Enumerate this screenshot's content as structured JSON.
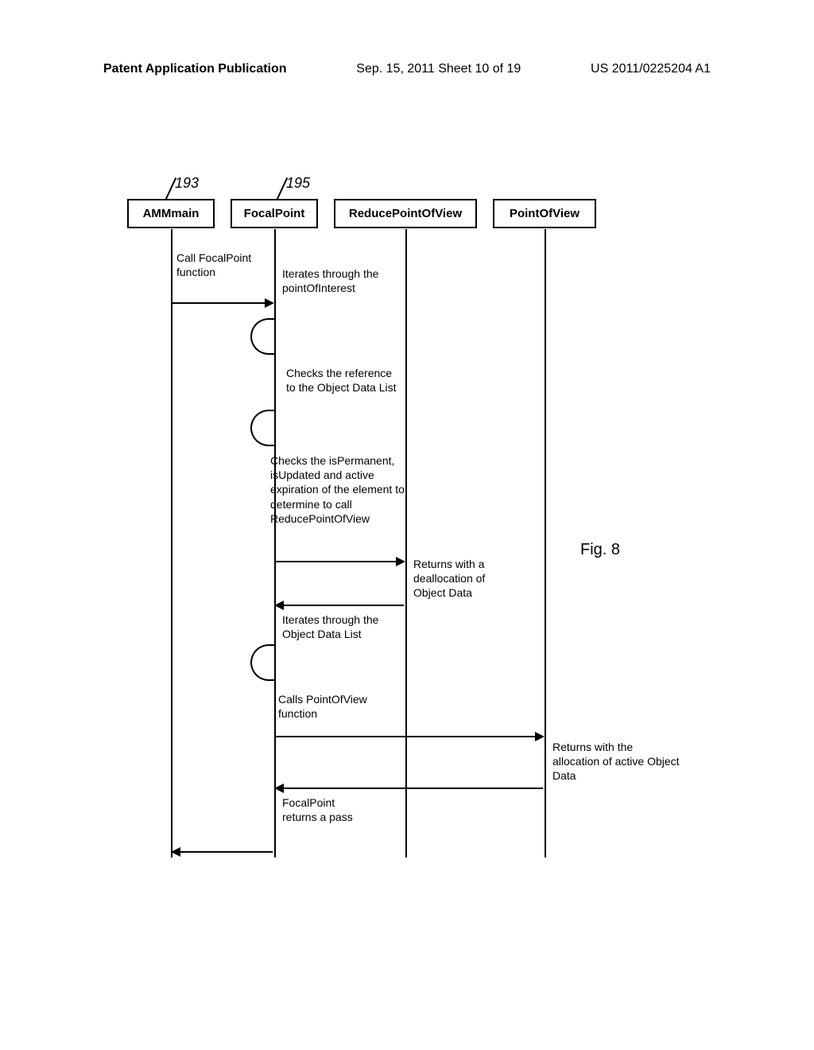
{
  "header": {
    "left": "Patent Application Publication",
    "center": "Sep. 15, 2011  Sheet 10 of 19",
    "right": "US 2011/0225204 A1"
  },
  "refs": {
    "r193": "193",
    "r195": "195"
  },
  "lifelines": {
    "ammmain": "AMMmain",
    "focalpoint": "FocalPoint",
    "reducepov": "ReducePointOfView",
    "pov": "PointOfView"
  },
  "messages": {
    "call_focal": "Call FocalPoint function",
    "iterates_poi": "Iterates through the pointOfInterest",
    "checks_ref": "Checks the reference to the Object Data List",
    "checks_perm": "Checks the isPermanent, isUpdated and active expiration of the element to determine to call ReducePointOfView",
    "returns_dealloc": "Returns with a deallocation of Object Data",
    "iterates_odl": "Iterates through the Object Data List",
    "calls_pov": "Calls PointOfView function",
    "returns_alloc": "Returns with the allocation of active Object Data",
    "focal_returns": "FocalPoint returns a pass"
  },
  "figure_label": "Fig. 8"
}
